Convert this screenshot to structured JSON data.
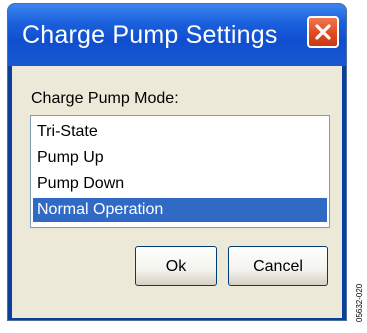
{
  "window": {
    "title": "Charge Pump Settings"
  },
  "group": {
    "label": "Charge Pump Mode:"
  },
  "list": {
    "items": [
      "Tri-State",
      "Pump Up",
      "Pump Down",
      "Normal Operation"
    ],
    "selected": "Normal Operation"
  },
  "buttons": {
    "ok_label": "Ok",
    "cancel_label": "Cancel"
  },
  "figure_code": "05632-020",
  "icons": {
    "close": "close-icon"
  },
  "colors": {
    "titlebar": "#0f4fcf",
    "close_button": "#e04a20",
    "selection": "#316ac5",
    "dialog_background": "#ece9d8"
  }
}
